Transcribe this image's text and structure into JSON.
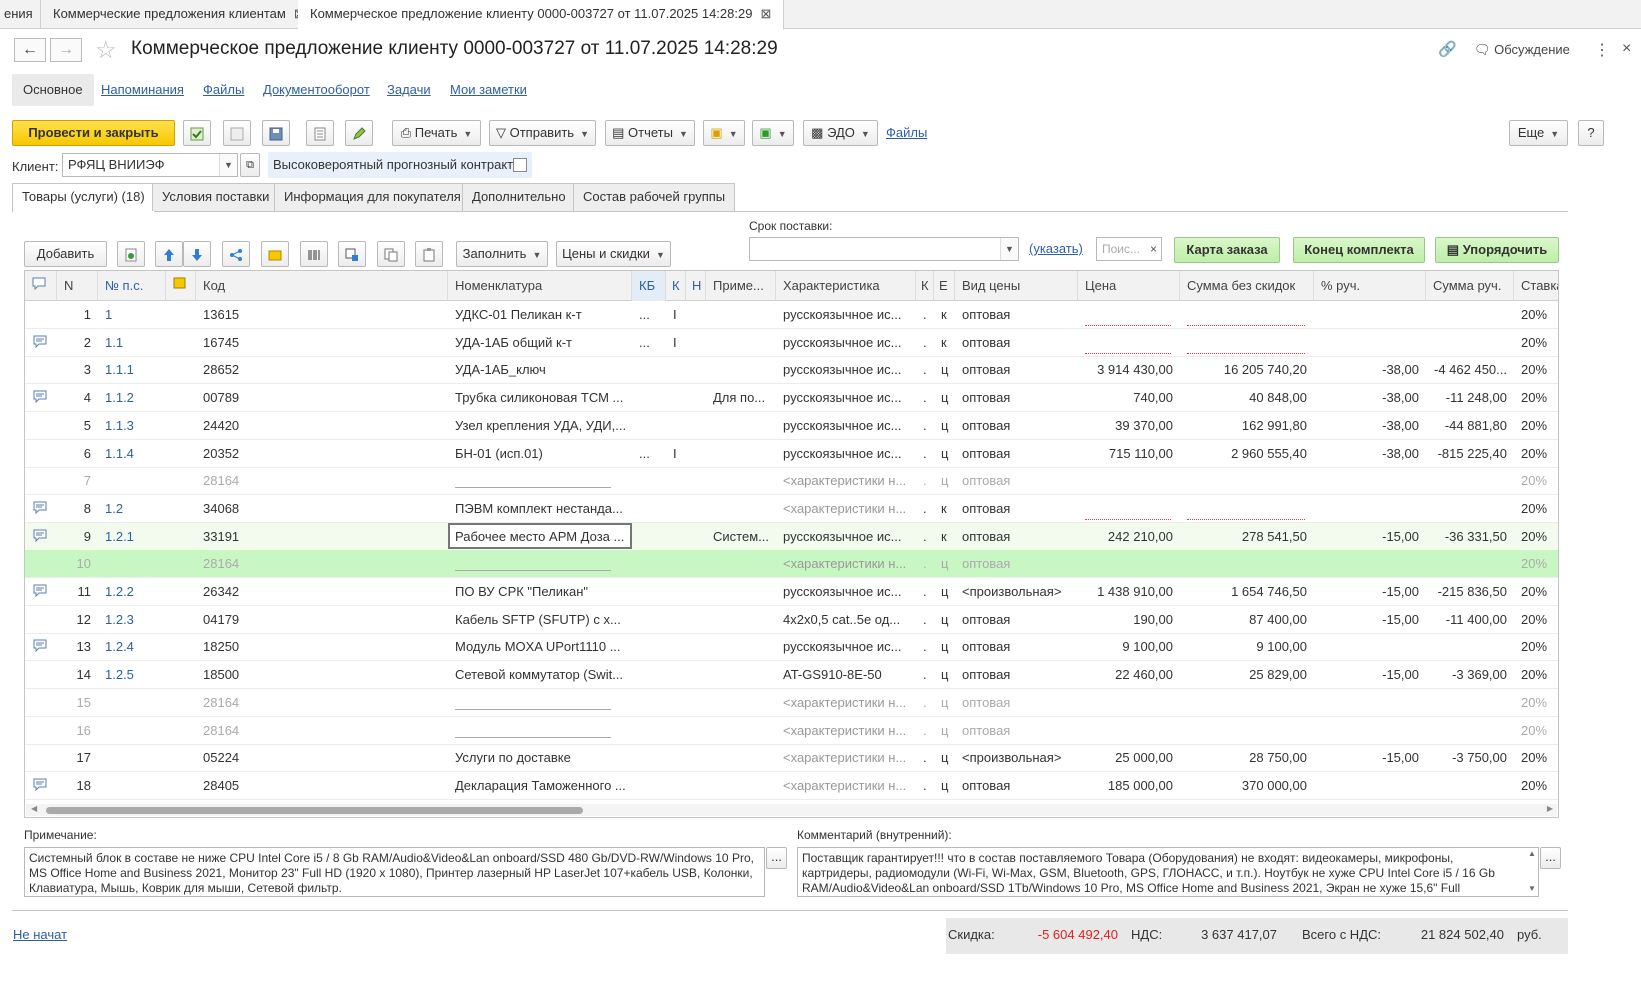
{
  "window_tabs": [
    {
      "label": "ения",
      "close": ""
    },
    {
      "label": "Коммерческие предложения клиентам",
      "close": "⊠"
    },
    {
      "label": "Коммерческое предложение клиенту 0000-003727 от 11.07.2025 14:28:29",
      "close": "⊠"
    }
  ],
  "header": {
    "title": "Коммерческое предложение клиенту 0000-003727 от 11.07.2025 14:28:29",
    "discussion": "Обсуждение"
  },
  "subtabs": [
    "Основное",
    "Напоминания",
    "Файлы",
    "Документооборот",
    "Задачи",
    "Мои заметки"
  ],
  "toolbar": {
    "post_close": "Провести и закрыть",
    "print": "Печать",
    "send": "Отправить",
    "reports": "Отчеты",
    "edo": "ЭДО",
    "files": "Файлы",
    "more": "Еще",
    "help": "?"
  },
  "client": {
    "label": "Клиент:",
    "value": "РФЯЦ ВНИИЭФ",
    "forecast_label": "Высоковероятный прогнозный контракт:"
  },
  "page_tabs": [
    "Товары (услуги) (18)",
    "Условия поставки",
    "Информация для покупателя",
    "Дополнительно",
    "Состав рабочей группы"
  ],
  "goods_toolbar": {
    "add": "Добавить",
    "fill": "Заполнить",
    "prices": "Цены и скидки",
    "delivery_label": "Срок поставки:",
    "specify": "(указать)",
    "search_placeholder": "Поис...",
    "order_map": "Карта заказа",
    "kit_end": "Конец комплекта",
    "arrange": "Упорядочить"
  },
  "table": {
    "headers": {
      "n": "N",
      "pos": "№ п.с.",
      "code": "Код",
      "nom": "Номенклатура",
      "kb": "КБ",
      "k": "К",
      "n2": "Н",
      "note": "Приме...",
      "char": "Характеристика",
      "k2": "К",
      "e": "Е",
      "price_type": "Вид цены",
      "price": "Цена",
      "sum": "Сумма без скидок",
      "pct": "% руч.",
      "sum_manual": "Сумма руч.",
      "rate": "Ставка"
    },
    "rows": [
      {
        "n": "1",
        "pos": "1",
        "code": "13615",
        "nom": "УДКС-01 Пеликан   к-т",
        "kb": "...",
        "k": "I",
        "note": "",
        "char": "русскоязычное ис...",
        "k2": ".",
        "e": "к",
        "pt": "оптовая",
        "price": "",
        "sum": "",
        "pct": "",
        "sm": "",
        "rate": "20%",
        "comment": false,
        "dim": false,
        "dotted": true
      },
      {
        "n": "2",
        "pos": "1.1",
        "code": "16745",
        "nom": "УДА-1АБ общий   к-т",
        "kb": "...",
        "k": "I",
        "note": "",
        "char": "русскоязычное ис...",
        "k2": ".",
        "e": "к",
        "pt": "оптовая",
        "price": "",
        "sum": "",
        "pct": "",
        "sm": "",
        "rate": "20%",
        "comment": true,
        "dim": false,
        "dotted": true
      },
      {
        "n": "3",
        "pos": "1.1.1",
        "code": "28652",
        "nom": "УДА-1АБ_ключ",
        "kb": "",
        "k": "",
        "note": "",
        "char": "русскоязычное ис...",
        "k2": ".",
        "e": "ц",
        "pt": "оптовая",
        "price": "3 914 430,00",
        "sum": "16 205 740,20",
        "pct": "-38,00",
        "sm": "-4 462 450...",
        "rate": "20%",
        "comment": false,
        "dim": false
      },
      {
        "n": "4",
        "pos": "1.1.2",
        "code": "00789",
        "nom": "Трубка силиконовая ТСМ ...",
        "kb": "",
        "k": "",
        "note": "Для по...",
        "char": "русскоязычное ис...",
        "k2": ".",
        "e": "ц",
        "pt": "оптовая",
        "price": "740,00",
        "sum": "40 848,00",
        "pct": "-38,00",
        "sm": "-11 248,00",
        "rate": "20%",
        "comment": true,
        "dim": false
      },
      {
        "n": "5",
        "pos": "1.1.3",
        "code": "24420",
        "nom": "Узел крепления УДА, УДИ,...",
        "kb": "",
        "k": "",
        "note": "",
        "char": "русскоязычное ис...",
        "k2": ".",
        "e": "ц",
        "pt": "оптовая",
        "price": "39 370,00",
        "sum": "162 991,80",
        "pct": "-38,00",
        "sm": "-44 881,80",
        "rate": "20%",
        "comment": false,
        "dim": false
      },
      {
        "n": "6",
        "pos": "1.1.4",
        "code": "20352",
        "nom": "БН-01 (исп.01)",
        "kb": "...",
        "k": "I",
        "note": "",
        "char": "русскоязычное ис...",
        "k2": ".",
        "e": "ц",
        "pt": "оптовая",
        "price": "715 110,00",
        "sum": "2 960 555,40",
        "pct": "-38,00",
        "sm": "-815 225,40",
        "rate": "20%",
        "comment": false,
        "dim": false
      },
      {
        "n": "7",
        "pos": "",
        "code": "28164",
        "nom": "",
        "kb": "",
        "k": "",
        "note": "",
        "char": "<характеристики н...",
        "k2": ".",
        "e": "ц",
        "pt": "оптовая",
        "price": "",
        "sum": "",
        "pct": "",
        "sm": "",
        "rate": "20%",
        "comment": false,
        "dim": true,
        "uline": true
      },
      {
        "n": "8",
        "pos": "1.2",
        "code": "34068",
        "nom": "ПЭВМ комплект нестанда...",
        "kb": "",
        "k": "",
        "note": "",
        "char": "<характеристики н...",
        "k2": ".",
        "e": "к",
        "pt": "оптовая",
        "price": "",
        "sum": "",
        "pct": "",
        "sm": "",
        "rate": "20%",
        "comment": true,
        "dim": false,
        "dotted": true,
        "charGrey": true
      },
      {
        "n": "9",
        "pos": "1.2.1",
        "code": "33191",
        "nom": "Рабочее место АРМ Доза ...",
        "kb": "",
        "k": "",
        "note": "Систем...",
        "char": "русскоязычное ис...",
        "k2": ".",
        "e": "к",
        "pt": "оптовая",
        "price": "242 210,00",
        "sum": "278 541,50",
        "pct": "-15,00",
        "sm": "-36 331,50",
        "rate": "20%",
        "comment": true,
        "dim": false,
        "sel": true
      },
      {
        "n": "10",
        "pos": "",
        "code": "28164",
        "nom": "",
        "kb": "",
        "k": "",
        "note": "",
        "char": "<характеристики н...",
        "k2": ".",
        "e": "ц",
        "pt": "оптовая",
        "price": "",
        "sum": "",
        "pct": "",
        "sm": "",
        "rate": "20%",
        "comment": false,
        "dim": true,
        "uline": true,
        "hl": true
      },
      {
        "n": "11",
        "pos": "1.2.2",
        "code": "26342",
        "nom": "ПО ВУ СРК \"Пеликан\"",
        "kb": "",
        "k": "",
        "note": "",
        "char": "русскоязычное ис...",
        "k2": ".",
        "e": "ц",
        "pt": "<произвольная>",
        "price": "1 438 910,00",
        "sum": "1 654 746,50",
        "pct": "-15,00",
        "sm": "-215 836,50",
        "rate": "20%",
        "comment": true,
        "dim": false
      },
      {
        "n": "12",
        "pos": "1.2.3",
        "code": "04179",
        "nom": "Кабель SFTP (SFUTP) с х...",
        "kb": "",
        "k": "",
        "note": "",
        "char": "4x2x0,5 cat..5e од...",
        "k2": ".",
        "e": "ц",
        "pt": "оптовая",
        "price": "190,00",
        "sum": "87 400,00",
        "pct": "-15,00",
        "sm": "-11 400,00",
        "rate": "20%",
        "comment": false,
        "dim": false
      },
      {
        "n": "13",
        "pos": "1.2.4",
        "code": "18250",
        "nom": "Модуль MOXA UPort1110 ...",
        "kb": "",
        "k": "",
        "note": "",
        "char": "русскоязычное ис...",
        "k2": ".",
        "e": "ц",
        "pt": "оптовая",
        "price": "9 100,00",
        "sum": "9 100,00",
        "pct": "",
        "sm": "",
        "rate": "20%",
        "comment": true,
        "dim": false
      },
      {
        "n": "14",
        "pos": "1.2.5",
        "code": "18500",
        "nom": "Сетевой коммутатор (Swit...",
        "kb": "",
        "k": "",
        "note": "",
        "char": "AT-GS910-8E-50",
        "k2": ".",
        "e": "ц",
        "pt": "оптовая",
        "price": "22 460,00",
        "sum": "25 829,00",
        "pct": "-15,00",
        "sm": "-3 369,00",
        "rate": "20%",
        "comment": false,
        "dim": false
      },
      {
        "n": "15",
        "pos": "",
        "code": "28164",
        "nom": "",
        "kb": "",
        "k": "",
        "note": "",
        "char": "<характеристики н...",
        "k2": ".",
        "e": "ц",
        "pt": "оптовая",
        "price": "",
        "sum": "",
        "pct": "",
        "sm": "",
        "rate": "20%",
        "comment": false,
        "dim": true,
        "uline": true
      },
      {
        "n": "16",
        "pos": "",
        "code": "28164",
        "nom": "",
        "kb": "",
        "k": "",
        "note": "",
        "char": "<характеристики н...",
        "k2": ".",
        "e": "ц",
        "pt": "оптовая",
        "price": "",
        "sum": "",
        "pct": "",
        "sm": "",
        "rate": "20%",
        "comment": false,
        "dim": true,
        "uline": true
      },
      {
        "n": "17",
        "pos": "",
        "code": "05224",
        "nom": "Услуги по доставке",
        "kb": "",
        "k": "",
        "note": "",
        "char": "<характеристики н...",
        "k2": ".",
        "e": "ц",
        "pt": "<произвольная>",
        "price": "25 000,00",
        "sum": "28 750,00",
        "pct": "-15,00",
        "sm": "-3 750,00",
        "rate": "20%",
        "comment": false,
        "dim": false,
        "charGrey": true
      },
      {
        "n": "18",
        "pos": "",
        "code": "28405",
        "nom": "Декларация Таможенного ...",
        "kb": "",
        "k": "",
        "note": "",
        "char": "<характеристики н...",
        "k2": ".",
        "e": "ц",
        "pt": "оптовая",
        "price": "185 000,00",
        "sum": "370 000,00",
        "pct": "",
        "sm": "",
        "rate": "20%",
        "comment": true,
        "dim": false,
        "charGrey": true
      }
    ]
  },
  "notes": {
    "label": "Примечание:",
    "text": "Системный блок в составе не ниже CPU Intel Core i5 / 8 Gb RAM/Audio&Video&Lan onboard/SSD 480 Gb/DVD-RW/Windows 10 Pro, MS Office Home and Business 2021, Монитор 23\" Full HD (1920 x 1080), Принтер лазерный HP LaserJet 107+кабель USB, Колонки, Клавиатура, Мышь, Коврик для мыши, Сетевой фильтр.",
    "btn": "..."
  },
  "comment": {
    "label": "Комментарий (внутренний):",
    "text": "Поставщик гарантирует!!! что в состав поставляемого Товара (Оборудования) не входят: видеокамеры, микрофоны, картридеры, радиомодули (Wi-Fi, Wi-Max, GSM, Bluetooth, GPS, ГЛОНАСС, и т.п.). Ноутбук не хуже CPU Intel Core i5 / 16 Gb RAM/Audio&Video&Lan onboard/SSD 1Tb/Windows 10 Pro, MS Office Home and Business 2021, Экран не хуже 15,6\" Full",
    "btn": "..."
  },
  "footer": {
    "status": "Не начат",
    "discount_label": "Скидка:",
    "discount_value": "-5 604 492,40",
    "vat_label": "НДС:",
    "vat_value": "3 637 417,07",
    "total_label": "Всего с НДС:",
    "total_value": "21 824 502,40",
    "currency": "руб."
  },
  "colors": {
    "accent_yellow": "#f5c800",
    "link_blue": "#2c5fa6",
    "negative_red": "#e02020",
    "highlight_green": "#c9f7c3"
  }
}
